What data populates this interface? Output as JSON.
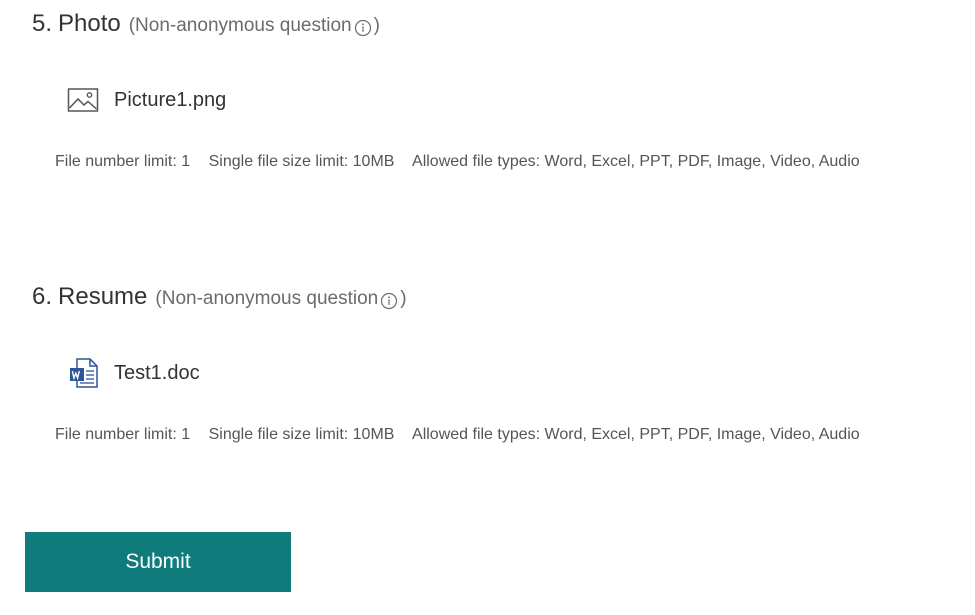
{
  "colors": {
    "accent": "#0f7b7b",
    "text": "#333333",
    "muted": "#6b6b6b"
  },
  "questions": [
    {
      "number": "5.",
      "title": "Photo",
      "note_open": "(Non-anonymous question",
      "note_close": ")",
      "info_icon": "info-icon",
      "file": {
        "icon": "image-icon",
        "name": "Picture1.png"
      },
      "limits": {
        "file_number": "File number limit: 1",
        "file_size": "Single file size limit: 10MB",
        "file_types": "Allowed file types: Word, Excel, PPT, PDF, Image, Video, Audio"
      }
    },
    {
      "number": "6.",
      "title": "Resume",
      "note_open": "(Non-anonymous question",
      "note_close": ")",
      "info_icon": "info-icon",
      "file": {
        "icon": "word-document-icon",
        "name": "Test1.doc"
      },
      "limits": {
        "file_number": "File number limit: 1",
        "file_size": "Single file size limit: 10MB",
        "file_types": "Allowed file types: Word, Excel, PPT, PDF, Image, Video, Audio"
      }
    }
  ],
  "submit": {
    "label": "Submit"
  }
}
